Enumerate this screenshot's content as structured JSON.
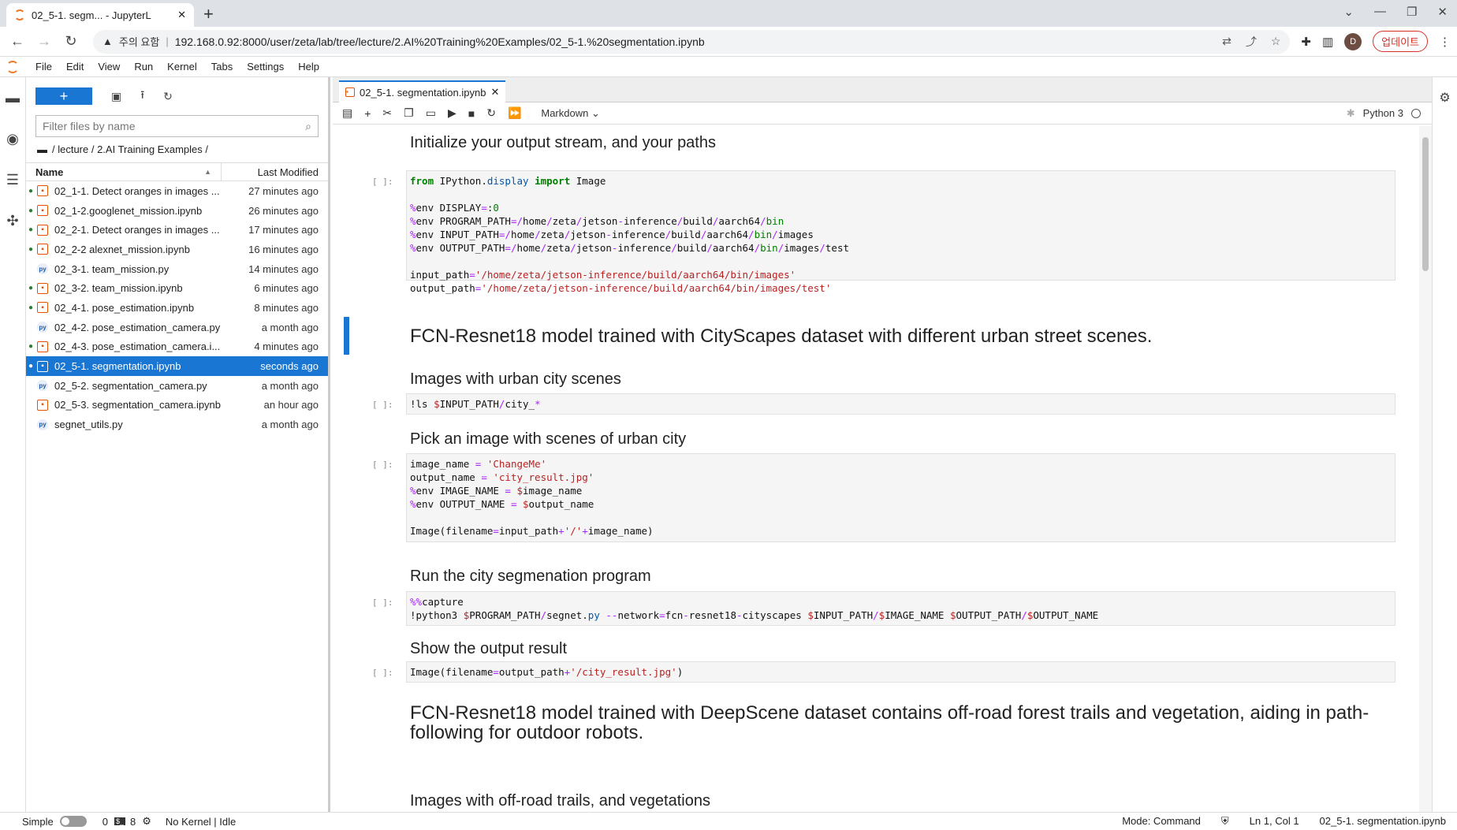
{
  "browser": {
    "tab_title": "02_5-1. segm... - JupyterL",
    "security_label": "주의 요함",
    "url": "192.168.0.92:8000/user/zeta/lab/tree/lecture/2.AI%20Training%20Examples/02_5-1.%20segmentation.ipynb",
    "profile_initial": "D",
    "update_label": "업데이트"
  },
  "menu": [
    "File",
    "Edit",
    "View",
    "Run",
    "Kernel",
    "Tabs",
    "Settings",
    "Help"
  ],
  "filebrowser": {
    "new_label": "+",
    "filter_placeholder": "Filter files by name",
    "breadcrumb": "/ lecture / 2.AI Training Examples /",
    "col_name": "Name",
    "col_modified": "Last Modified",
    "files": [
      {
        "name": "02_1-1. Detect oranges in images ...",
        "modified": "27 minutes ago",
        "type": "nb",
        "running": true
      },
      {
        "name": "02_1-2.googlenet_mission.ipynb",
        "modified": "26 minutes ago",
        "type": "nb",
        "running": true
      },
      {
        "name": "02_2-1. Detect oranges in images ...",
        "modified": "17 minutes ago",
        "type": "nb",
        "running": true
      },
      {
        "name": "02_2-2 alexnet_mission.ipynb",
        "modified": "16 minutes ago",
        "type": "nb",
        "running": true
      },
      {
        "name": "02_3-1. team_mission.py",
        "modified": "14 minutes ago",
        "type": "py",
        "running": false
      },
      {
        "name": "02_3-2. team_mission.ipynb",
        "modified": "6 minutes ago",
        "type": "nb",
        "running": true
      },
      {
        "name": "02_4-1. pose_estimation.ipynb",
        "modified": "8 minutes ago",
        "type": "nb",
        "running": true
      },
      {
        "name": "02_4-2. pose_estimation_camera.py",
        "modified": "a month ago",
        "type": "py",
        "running": false
      },
      {
        "name": "02_4-3. pose_estimation_camera.i...",
        "modified": "4 minutes ago",
        "type": "nb",
        "running": true
      },
      {
        "name": "02_5-1. segmentation.ipynb",
        "modified": "seconds ago",
        "type": "nb",
        "running": true,
        "selected": true
      },
      {
        "name": "02_5-2. segmentation_camera.py",
        "modified": "a month ago",
        "type": "py",
        "running": false
      },
      {
        "name": "02_5-3. segmentation_camera.ipynb",
        "modified": "an hour ago",
        "type": "nb",
        "running": false
      },
      {
        "name": "segnet_utils.py",
        "modified": "a month ago",
        "type": "py",
        "running": false
      }
    ]
  },
  "notebook": {
    "tab_title": "02_5-1. segmentation.ipynb",
    "cell_type": "Markdown",
    "kernel_name": "Python 3",
    "prompt": "[ ]:",
    "md1": "Initialize your output stream, and your paths",
    "h1a": "FCN-Resnet18 model trained with CityScapes dataset with different urban street scenes.",
    "md2": "Images with urban city scenes",
    "md3": "Pick an image with scenes of urban city",
    "md4": "Run the city segmenation program",
    "md5": "Show the output result",
    "h1b": "FCN-Resnet18 model trained with DeepScene dataset contains off-road forest trails and vegetation, aiding in path-following for outdoor robots.",
    "md6": "Images with off-road trails, and vegetations"
  },
  "status": {
    "mode_label": "Simple",
    "count_a": "0",
    "count_b": "8",
    "kernel_status": "No Kernel | Idle",
    "mode": "Mode: Command",
    "position": "Ln 1, Col 1",
    "filename": "02_5-1. segmentation.ipynb"
  }
}
